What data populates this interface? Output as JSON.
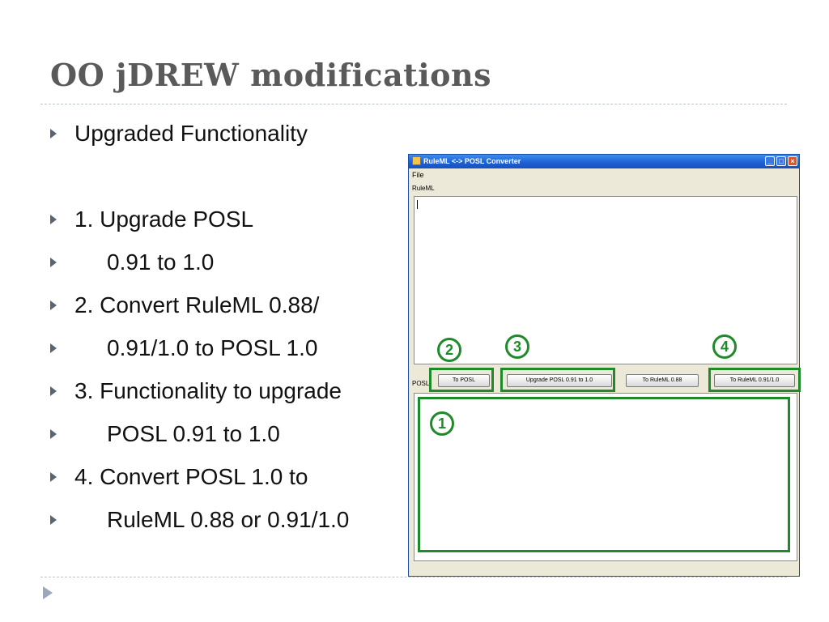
{
  "slide": {
    "title": "OO jDREW modifications",
    "bullets": [
      {
        "text": "Upgraded Functionality",
        "indent": false
      },
      {
        "text": "1. Upgrade POSL",
        "indent": false
      },
      {
        "text": "0.91 to 1.0",
        "indent": true
      },
      {
        "text": "2. Convert RuleML 0.88/",
        "indent": false
      },
      {
        "text": "0.91/1.0 to POSL 1.0",
        "indent": true
      },
      {
        "text": "3. Functionality to upgrade",
        "indent": false
      },
      {
        "text": "POSL 0.91 to 1.0",
        "indent": true
      },
      {
        "text": "4. Convert POSL 1.0 to",
        "indent": false
      },
      {
        "text": "RuleML 0.88 or 0.91/1.0",
        "indent": true
      }
    ]
  },
  "window": {
    "title": "RuleML <-> POSL Converter",
    "menu_file": "File",
    "label_ruleml": "RuleML",
    "label_posl": "POSL",
    "buttons": {
      "to_posl": "To POSL",
      "upgrade_posl": "Upgrade POSL 0.91 to 1.0",
      "to_ruleml_088": "To RuleML 0.88",
      "to_ruleml_091": "To RuleML 0.91/1.0"
    }
  },
  "callouts": {
    "n1": "1",
    "n2": "2",
    "n3": "3",
    "n4": "4",
    "color": "#1f8a2a"
  },
  "colors": {
    "title_text": "#5a5a5a",
    "bullet_arrow": "#5b6572",
    "titlebar_blue": "#1d5fd0"
  }
}
